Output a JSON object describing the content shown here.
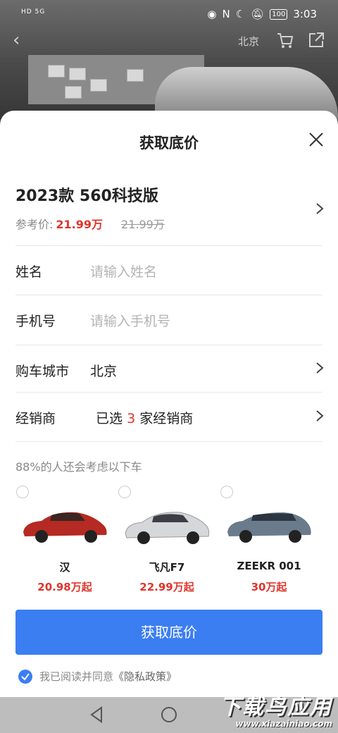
{
  "status_bar": {
    "left_text": "HD 5G",
    "battery": "100",
    "time": "3:03"
  },
  "top_bar": {
    "city": "北京"
  },
  "sheet": {
    "title": "获取底价",
    "model_name": "2023款  560科技版",
    "ref_label": "参考价:",
    "ref_price": "21.99万",
    "orig_price": "21.99万"
  },
  "form": {
    "name_label": "姓名",
    "name_placeholder": "请输入姓名",
    "phone_label": "手机号",
    "phone_placeholder": "请输入手机号",
    "city_label": "购车城市",
    "city_value": "北京",
    "dealer_label": "经销商",
    "dealer_prefix": "已选",
    "dealer_count": "3",
    "dealer_suffix": "家经销商"
  },
  "recommend": {
    "hint": "88%的人还会考虑以下车",
    "cars": [
      {
        "name": "汉",
        "price": "20.98万起",
        "color": "#b52a22"
      },
      {
        "name": "飞凡F7",
        "price": "22.99万起",
        "color": "#d5d7da"
      },
      {
        "name": "ZEEKR 001",
        "price": "30万起",
        "color": "#6a7b8c"
      }
    ]
  },
  "button_label": "获取底价",
  "agreement": {
    "text": "我已阅读并同意",
    "link": "《隐私政策》"
  },
  "watermark": {
    "big": "下载鸟应用",
    "small": "www.xiazainiao.com"
  },
  "colors": {
    "accent": "#3b7ef2",
    "price_red": "#e0352b"
  }
}
